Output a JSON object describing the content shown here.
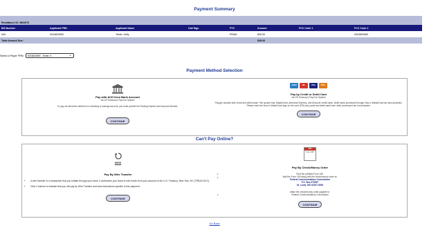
{
  "page_title": "Payment Summary",
  "remittance": {
    "label": "Remittance ID: 3802676",
    "columns": [
      "Bill Number",
      "Applicant FRN",
      "Applicant Name",
      "Call Sign",
      "PTC",
      "Amount",
      "FCC Code 1",
      "FCC Code 2"
    ],
    "rows": [
      [
        "N/A",
        "0024823690",
        "Tester, Kelly",
        "",
        "PRAM",
        "$35.00",
        "",
        "0003809483"
      ]
    ],
    "total_label": "Total Amount Due :",
    "total_value": "$35.00"
  },
  "payer": {
    "label": "Select a Payer FRN:",
    "selected": "0024823690 - Tester, K"
  },
  "payment_method": {
    "title": "Payment Method Selection",
    "ach": {
      "icon": "bank-icon",
      "title": "Pay with ACH from Bank Account",
      "subtitle": "via US Treasury's Pay.Gov System",
      "description": "To pay via electronic debit from a checking or savings account, you must provide the Routing Number and Account Number.",
      "button": "CONTINUE"
    },
    "card": {
      "logos": [
        "AMEX",
        "MC",
        "VISA",
        "DISC"
      ],
      "title": "Pay by Credit or Debit Card",
      "subtitle": "via US Treasury's Pay.Gov System",
      "description": "Pay.gov accepts both credit and debit cards.* We accept Visa, MasterCard, American Express, and Discover credit cards. Debit cards processed through Visa or MasterCard are also accepted. Please have the Visa or MasterCard logo on the card. ATM-only cards and debit cards from other processors are not accepted.",
      "button": "CONTINUE"
    }
  },
  "cant_pay": {
    "title": "Can't Pay Online?",
    "wire": {
      "icon_label": "WIRE",
      "title": "Pay By Wire Transfer",
      "bullets": [
        "A wire transfer is a transaction that you initiate through your bank. It authorizes your bank to wire funds from your account to the U.S. Treasury, New York, NY (TREAS NYC).",
        "Click Continue to indicate that you will pay by Wire Transfer and view instructions specific to this payment."
      ],
      "button": "CONTINUE"
    },
    "check": {
      "icon_label": "Form 159",
      "title": "Pay By Check/Money Order",
      "line1": "Print the prefilled Form 159.",
      "line2": "Mail the Form 159 along with the check/money order to:",
      "addr1": "Federal Communications Commission",
      "addr2": "P.O. Box 979097",
      "addr3": "St. Louis, MO 63197-9000",
      "line3": "Make the check/money order payable to:",
      "line4": "Federal Communications Commission",
      "button": "CONTINUE"
    }
  },
  "back_link": "Go Back",
  "colors": {
    "header_blue": "#16187a",
    "title_blue": "#1f3a93",
    "band": "#b7bdd9",
    "button_bg": "#d6d9ec"
  }
}
